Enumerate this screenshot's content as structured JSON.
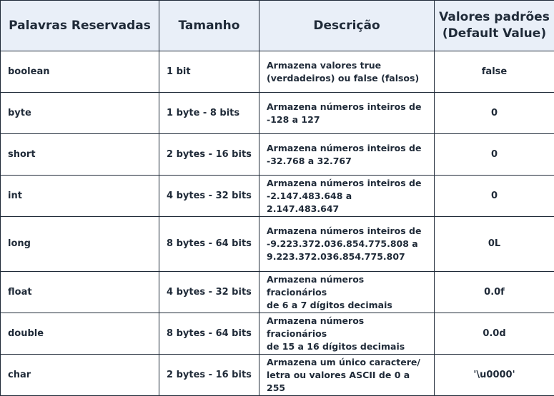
{
  "table": {
    "headers": [
      "Palavras Reservadas",
      "Tamanho",
      "Descrição",
      [
        "Valores padrões",
        "(Default Value)"
      ]
    ],
    "rows": [
      {
        "keyword": "boolean",
        "size": "1 bit",
        "description": [
          "Armazena valores true",
          "(verdadeiros) ou false (falsos)"
        ],
        "default": "false"
      },
      {
        "keyword": "byte",
        "size": "1 byte - 8 bits",
        "description": [
          "Armazena números inteiros de",
          "-128 a 127"
        ],
        "default": "0"
      },
      {
        "keyword": "short",
        "size": "2 bytes - 16 bits",
        "description": [
          "Armazena números inteiros de",
          "-32.768 a 32.767"
        ],
        "default": "0"
      },
      {
        "keyword": "int",
        "size": "4 bytes - 32 bits",
        "description": [
          "Armazena números inteiros de",
          "-2.147.483.648 a 2.147.483.647"
        ],
        "default": "0"
      },
      {
        "keyword": "long",
        "size": "8 bytes - 64 bits",
        "description": [
          "Armazena números inteiros de",
          "-9.223.372.036.854.775.808 a",
          "9.223.372.036.854.775.807"
        ],
        "default": "0L"
      },
      {
        "keyword": "float",
        "size": "4 bytes - 32 bits",
        "description": [
          "Armazena números fracionários",
          "de 6 a 7 dígitos decimais"
        ],
        "default": "0.0f"
      },
      {
        "keyword": "double",
        "size": "8 bytes - 64 bits",
        "description": [
          "Armazena números fracionários",
          "de 15 a 16 dígitos decimais"
        ],
        "default": "0.0d"
      },
      {
        "keyword": "char",
        "size": "2 bytes - 16 bits",
        "description": [
          "Armazena um único caractere/",
          "letra ou valores ASCII de 0 a 255"
        ],
        "default": "'\\u0000'"
      }
    ]
  }
}
